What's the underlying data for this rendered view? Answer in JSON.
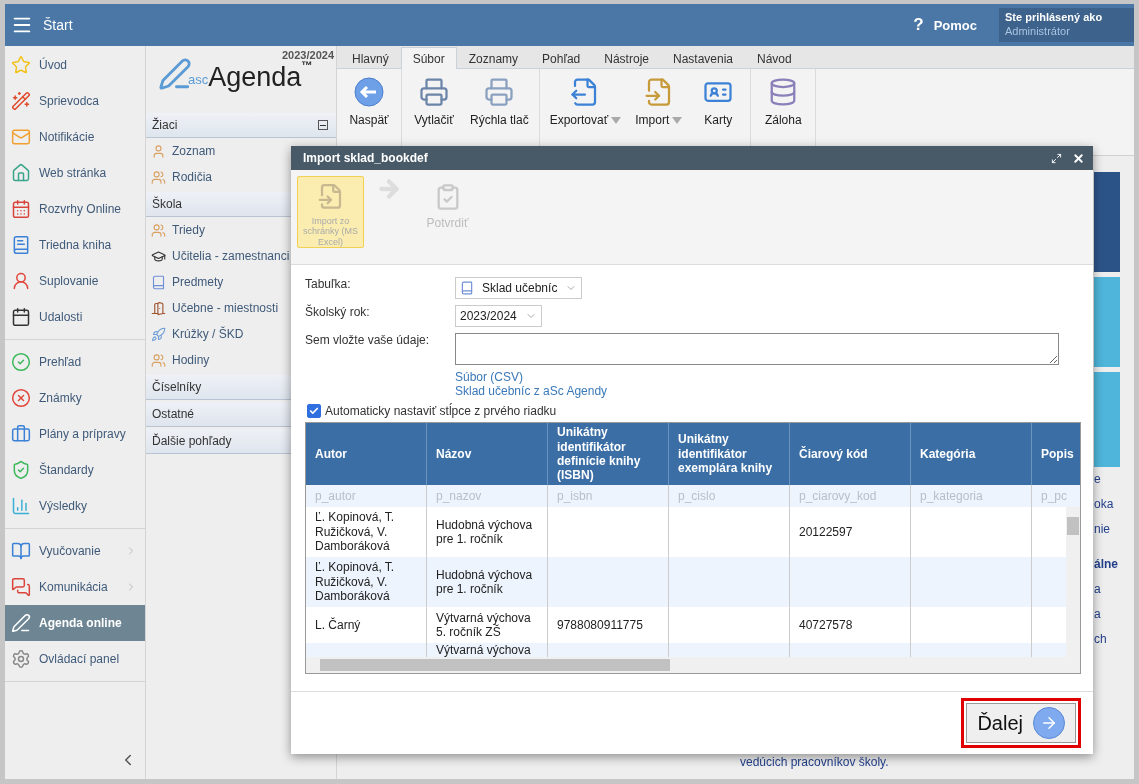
{
  "topbar": {
    "title": "Štart",
    "help": "Pomoc",
    "help_icon": "?",
    "user_caption": "Ste prihlásený ako",
    "user_name": "Administrátor"
  },
  "sidebar": {
    "groups": [
      [
        {
          "label": "Úvod",
          "selected": false,
          "submenu": false
        },
        {
          "label": "Sprievodca",
          "selected": false,
          "submenu": false
        },
        {
          "label": "Notifikácie",
          "selected": false,
          "submenu": false
        },
        {
          "label": "Web stránka",
          "selected": false,
          "submenu": false
        },
        {
          "label": "Rozvrhy Online",
          "selected": false,
          "submenu": false
        },
        {
          "label": "Triedna kniha",
          "selected": false,
          "submenu": false
        },
        {
          "label": "Suplovanie",
          "selected": false,
          "submenu": false
        },
        {
          "label": "Udalosti",
          "selected": false,
          "submenu": false
        }
      ],
      [
        {
          "label": "Prehľad",
          "selected": false,
          "submenu": false
        },
        {
          "label": "Známky",
          "selected": false,
          "submenu": false
        },
        {
          "label": "Plány a prípravy",
          "selected": false,
          "submenu": false
        },
        {
          "label": "Štandardy",
          "selected": false,
          "submenu": false
        },
        {
          "label": "Výsledky",
          "selected": false,
          "submenu": false
        }
      ],
      [
        {
          "label": "Vyučovanie",
          "selected": false,
          "submenu": true
        },
        {
          "label": "Komunikácia",
          "selected": false,
          "submenu": true
        },
        {
          "label": "Agenda online",
          "selected": true,
          "submenu": false
        },
        {
          "label": "Ovládací panel",
          "selected": false,
          "submenu": false
        }
      ]
    ]
  },
  "subpanel": {
    "year": "2023/2024",
    "logo": {
      "prefix": "asc",
      "name": "Agenda",
      "mark": "™"
    },
    "sections": [
      {
        "title": "Žiaci",
        "items": [
          "Zoznam",
          "Rodičia"
        ]
      },
      {
        "title": "Škola",
        "items": [
          "Triedy",
          "Učitelia - zamestnanci",
          "Predmety",
          "Učebne - miestnosti",
          "Krúžky / ŠKD",
          "Hodiny"
        ]
      },
      {
        "title": "Číselníky"
      },
      {
        "title": "Ostatné"
      },
      {
        "title": "Ďalšie pohľady"
      }
    ]
  },
  "ribbon": {
    "tabs": [
      {
        "label": "Hlavný",
        "selected": false
      },
      {
        "label": "Súbor",
        "selected": true
      },
      {
        "label": "Zoznamy",
        "selected": false
      },
      {
        "label": "Pohľad",
        "selected": false
      },
      {
        "label": "Nástroje",
        "selected": false
      },
      {
        "label": "Nastavenia",
        "selected": false
      },
      {
        "label": "Návod",
        "selected": false
      }
    ],
    "groups": [
      [
        {
          "label": "Naspäť",
          "dropdown": false
        }
      ],
      [
        {
          "label": "Vytlačiť",
          "dropdown": false
        },
        {
          "label": "Rýchla tlač",
          "dropdown": false
        }
      ],
      [
        {
          "label": "Exportovať",
          "dropdown": true
        },
        {
          "label": "Import",
          "dropdown": true
        },
        {
          "label": "Karty",
          "dropdown": false
        }
      ],
      [
        {
          "label": "Záloha",
          "dropdown": false
        }
      ]
    ]
  },
  "background": {
    "fragments": [
      "e",
      "oka",
      "nie",
      "álne",
      "a",
      "a",
      "ch"
    ],
    "footer_text": "vedúcich pracovníkov školy."
  },
  "dialog": {
    "title": "Import sklad_bookdef",
    "steps": [
      {
        "label": "Import zo schránky (MS Excel)",
        "selected": true,
        "disabled": false
      },
      {
        "label": "Potvrdiť",
        "selected": false,
        "disabled": true
      }
    ],
    "form": {
      "table_label": "Tabuľka:",
      "table_value": "Sklad učebníc",
      "year_label": "Školský rok:",
      "year_value": "2023/2024",
      "paste_label": "Sem vložte vaše údaje:",
      "links": [
        "Súbor (CSV)",
        "Sklad učebníc z aSc Agendy"
      ],
      "auto_columns": {
        "label": "Automaticky nastaviť stĺpce z prvého riadku",
        "checked": true
      }
    },
    "table": {
      "columns": [
        "Autor",
        "Názov",
        "Unikátny identifikátor definície knihy (ISBN)",
        "Unikátny identifikátor exemplára knihy",
        "Čiarový kód",
        "Kategória",
        "Popis"
      ],
      "field_names": [
        "p_autor",
        "p_nazov",
        "p_isbn",
        "p_cislo",
        "p_ciarovy_kod",
        "p_kategoria",
        "p_pc"
      ],
      "rows": [
        [
          "Ľ. Kopinová, T. Ružičková, V. Damboráková",
          "Hudobná výchova pre 1. ročník",
          "",
          "",
          "20122597",
          "",
          ""
        ],
        [
          "Ľ. Kopinová, T. Ružičková, V. Damboráková",
          "Hudobná výchova pre 1. ročník",
          "",
          "",
          "",
          "",
          ""
        ],
        [
          "L. Čarný",
          "Výtvarná výchova 5. ročník ZŠ",
          "9788080911775",
          "",
          "40727578",
          "",
          ""
        ],
        [
          "",
          "Výtvarná výchova",
          "",
          "",
          "",
          "",
          ""
        ]
      ]
    },
    "next_button": "Ďalej"
  }
}
